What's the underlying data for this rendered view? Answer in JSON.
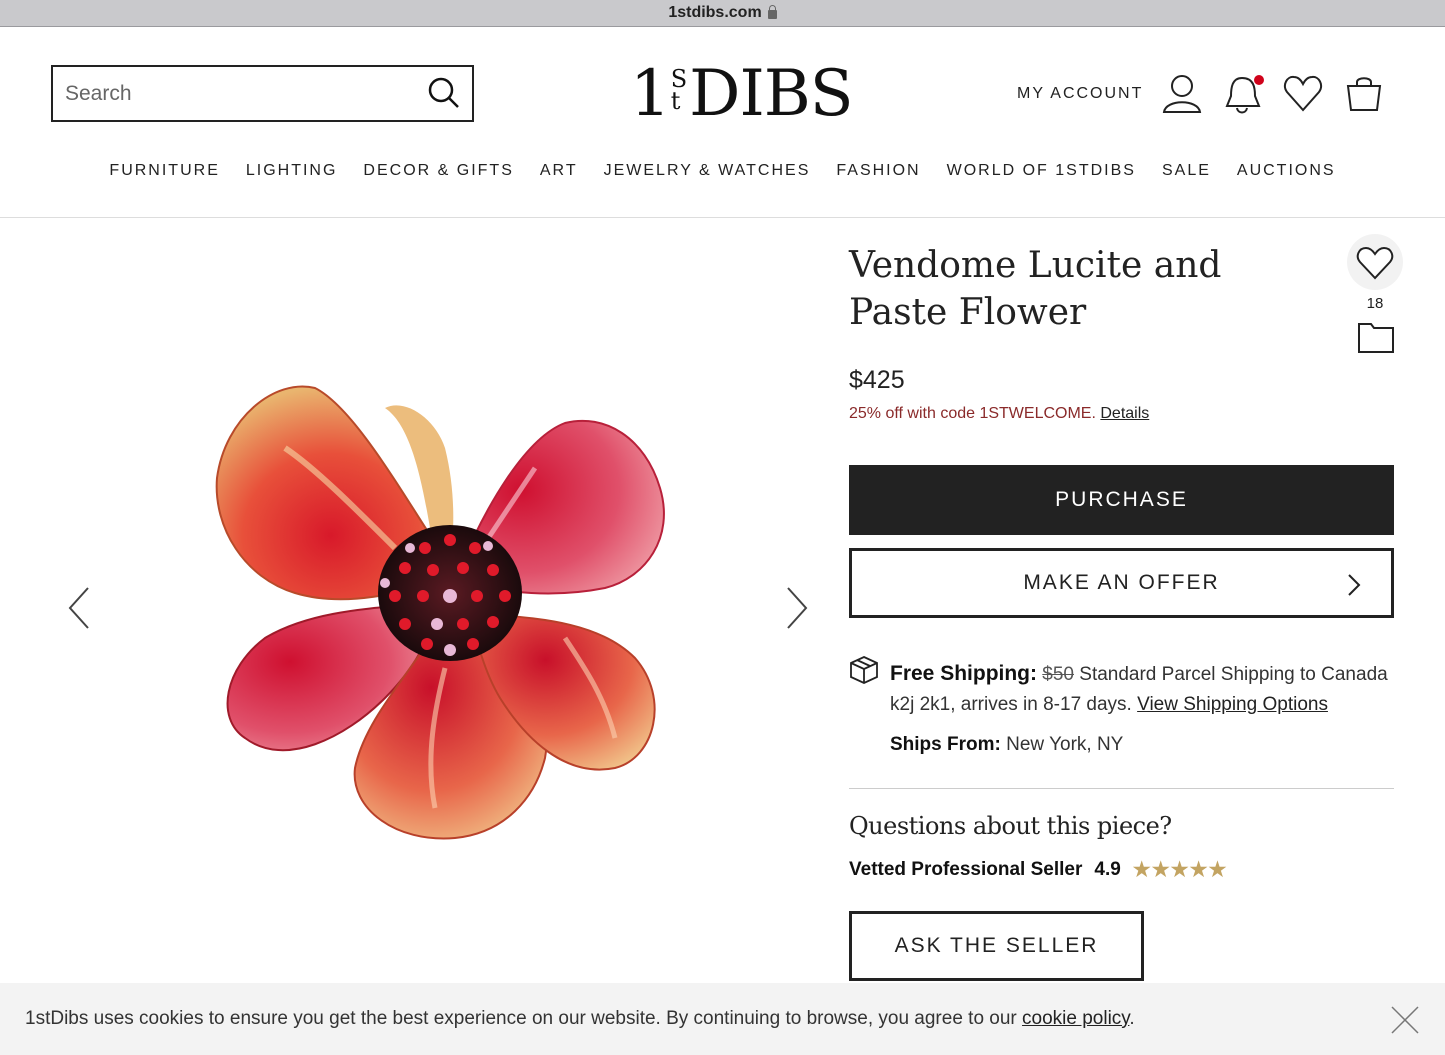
{
  "browser": {
    "url": "1stdibs.com"
  },
  "header": {
    "search_placeholder": "Search",
    "logo": {
      "one": "1",
      "s": "S",
      "t": "t",
      "dibs": "DIBS"
    },
    "account_label": "MY ACCOUNT",
    "notification_dot_color": "#d0021b"
  },
  "nav": {
    "items": [
      "FURNITURE",
      "LIGHTING",
      "DECOR & GIFTS",
      "ART",
      "JEWELRY & WATCHES",
      "FASHION",
      "WORLD OF 1STDIBS",
      "SALE",
      "AUCTIONS"
    ]
  },
  "product": {
    "title": "Vendome Lucite and Paste Flower",
    "favorites_count": "18",
    "price": "$425",
    "promo_text": "25% off with code 1STWELCOME.",
    "promo_link": "Details",
    "purchase_label": "PURCHASE",
    "offer_label": "MAKE AN OFFER"
  },
  "shipping": {
    "label": "Free Shipping:",
    "old_price": "$50",
    "text": "Standard Parcel Shipping to Canada k2j 2k1, arrives in 8-17 days.",
    "link": "View Shipping Options",
    "ships_from_label": "Ships From:",
    "ships_from_value": "New York, NY"
  },
  "seller": {
    "questions_heading": "Questions about this piece?",
    "label": "Vetted Professional Seller",
    "rating": "4.9",
    "stars": "★★★★★",
    "star_color": "#c3a462",
    "ask_label": "ASK THE SELLER"
  },
  "cookie": {
    "text": "1stDibs uses cookies to ensure you get the best experience on our website. By continuing to browse, you agree to our",
    "link": "cookie policy",
    "end": "."
  }
}
